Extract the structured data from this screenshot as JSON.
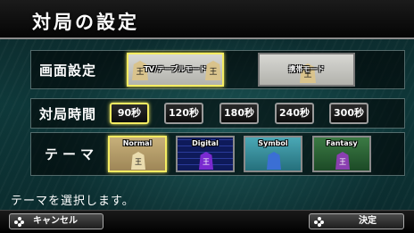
{
  "title": "対局の設定",
  "display_mode": {
    "label": "画面設定",
    "options": [
      {
        "label": "TV/テーブルモード",
        "selected": true
      },
      {
        "label": "携帯モード",
        "selected": false
      }
    ]
  },
  "time": {
    "label": "対局時間",
    "options": [
      {
        "label": "90秒",
        "selected": true
      },
      {
        "label": "120秒",
        "selected": false
      },
      {
        "label": "180秒",
        "selected": false
      },
      {
        "label": "240秒",
        "selected": false
      },
      {
        "label": "300秒",
        "selected": false
      }
    ]
  },
  "theme": {
    "label": "テーマ",
    "options": [
      {
        "label": "Normal",
        "selected": true
      },
      {
        "label": "Digital",
        "selected": false
      },
      {
        "label": "Symbol",
        "selected": false
      },
      {
        "label": "Fantasy",
        "selected": false
      }
    ]
  },
  "status": "テーマを選択します。",
  "footer": {
    "cancel_label": "キャンセル",
    "confirm_label": "決定"
  },
  "piece_char": "王",
  "colors": {
    "selected_border": "#f4ec62",
    "accent": "#1f6f72"
  }
}
